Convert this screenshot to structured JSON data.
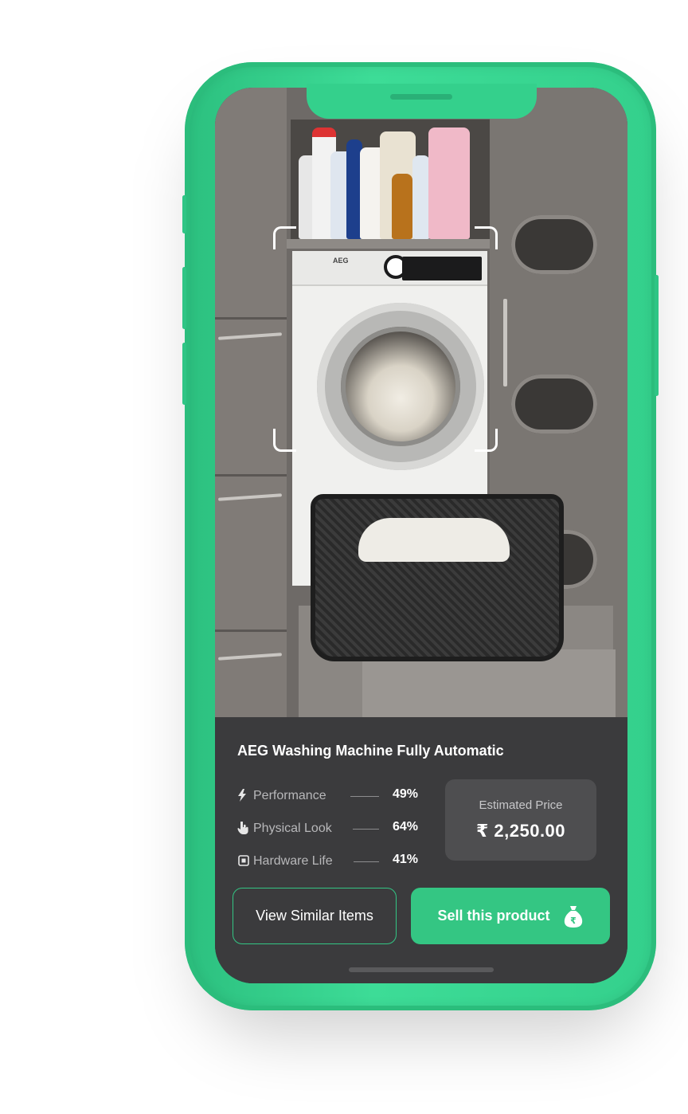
{
  "product": {
    "title": "AEG Washing Machine Fully Automatic",
    "brand_label": "AEG"
  },
  "metrics": [
    {
      "icon": "lightning-icon",
      "label": "Performance",
      "value": "49%"
    },
    {
      "icon": "hand-pointer-icon",
      "label": "Physical Look",
      "value": "64%"
    },
    {
      "icon": "chip-icon",
      "label": "Hardware Life",
      "value": "41%"
    }
  ],
  "price": {
    "label": "Estimated Price",
    "value": "₹ 2,250.00"
  },
  "actions": {
    "similar_label": "View Similar Items",
    "sell_label": "Sell this product",
    "sell_icon": "money-bag-rupee-icon"
  },
  "colors": {
    "accent": "#34c683",
    "phone_frame": "#34d08c",
    "panel_bg": "#3b3b3d",
    "price_box_bg": "#4e4e50"
  }
}
